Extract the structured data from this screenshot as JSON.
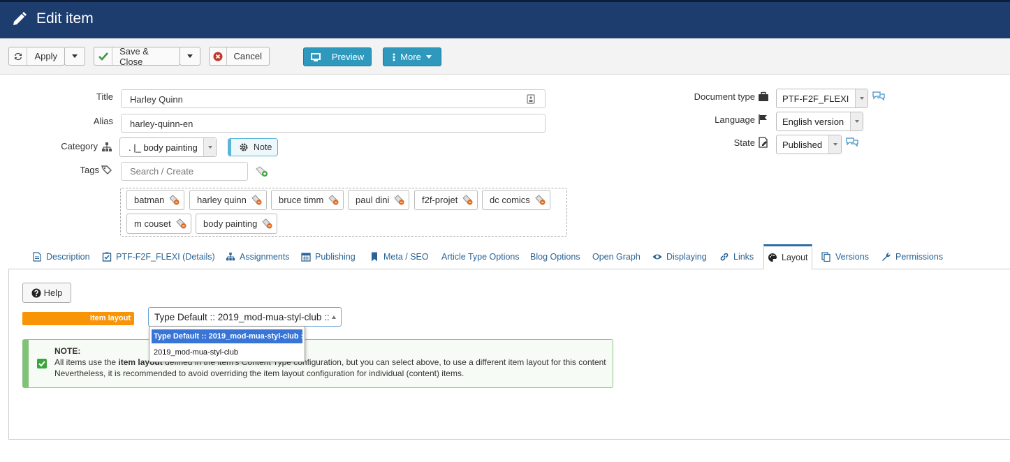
{
  "header": {
    "title": "Edit item"
  },
  "toolbar": {
    "apply": "Apply",
    "save_close": "Save & Close",
    "cancel": "Cancel",
    "preview": "Preview",
    "more": "More"
  },
  "form": {
    "title_label": "Title",
    "title_value": "Harley Quinn",
    "alias_label": "Alias",
    "alias_value": "harley-quinn-en",
    "category_label": "Category",
    "category_value": ". |_ body painting",
    "note_button": "Note",
    "tags_label": "Tags",
    "tags_placeholder": "Search / Create",
    "tags": [
      "batman",
      "harley quinn",
      "bruce timm",
      "paul dini",
      "f2f-projet",
      "dc comics",
      "m couset",
      "body painting"
    ],
    "document_type_label": "Document type",
    "document_type_value": "PTF-F2F_FLEXI",
    "language_label": "Language",
    "language_value": "English version",
    "state_label": "State",
    "state_value": "Published"
  },
  "tabs": [
    {
      "label": "Description",
      "icon": "document-icon"
    },
    {
      "label": "PTF-F2F_FLEXI (Details)",
      "icon": "checkbox-icon"
    },
    {
      "label": "Assignments",
      "icon": "sitemap-icon"
    },
    {
      "label": "Publishing",
      "icon": "calendar-icon"
    },
    {
      "label": "Meta / SEO",
      "icon": "bookmark-icon"
    },
    {
      "label": "Article Type Options",
      "icon": ""
    },
    {
      "label": "Blog Options",
      "icon": ""
    },
    {
      "label": "Open Graph",
      "icon": ""
    },
    {
      "label": "Displaying",
      "icon": "eye-icon"
    },
    {
      "label": "Links",
      "icon": "link-icon"
    },
    {
      "label": "Layout",
      "icon": "palette-icon",
      "active": true
    },
    {
      "label": "Versions",
      "icon": "copy-icon"
    },
    {
      "label": "Permissions",
      "icon": "wrench-icon"
    }
  ],
  "layout_panel": {
    "help": "Help",
    "item_layout_label": "Item layout",
    "selected_layout": "Type Default :: 2019_mod-mua-styl-club ::",
    "options": [
      "Type Default :: 2019_mod-mua-styl-club ::",
      "2019_mod-mua-styl-club"
    ],
    "note_title": "NOTE:",
    "note_line1_a": "All items use the ",
    "note_line1_b": "item layout",
    "note_line1_c": " defined in the item's Content Type configuration, but you can select above, to use a different item layout for this content",
    "note_line2": "Nevertheless, it is recommended to avoid overriding the item layout configuration for individual (content) items."
  },
  "colors": {
    "header_bg": "#1c3d6e",
    "preview_button": "#2f98bd",
    "item_layout_label": "#f89406",
    "note_border": "#82c17a",
    "dropdown_selected": "#3875d7"
  }
}
